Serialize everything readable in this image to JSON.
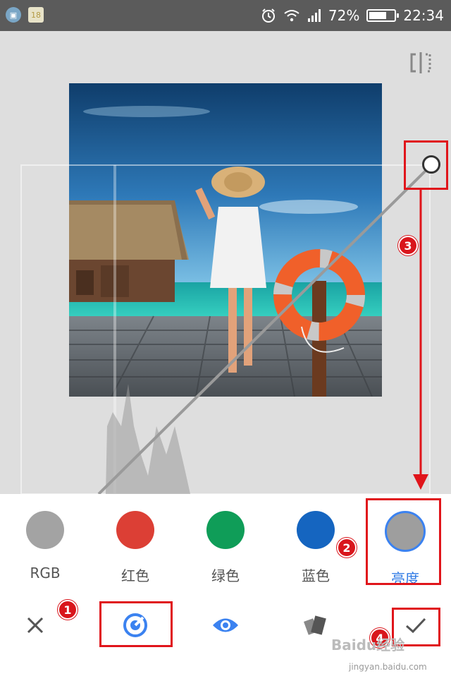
{
  "status_bar": {
    "notification_icons": [
      "image-icon",
      "calendar-icon"
    ],
    "calendar_day": "18",
    "battery_percent": "72%",
    "battery_level": 0.72,
    "time": "22:34"
  },
  "channels": [
    {
      "label": "RGB",
      "color": "#a3a3a3",
      "active": false
    },
    {
      "label": "红色",
      "color": "#dc3f35",
      "active": false
    },
    {
      "label": "绿色",
      "color": "#0f9d58",
      "active": false
    },
    {
      "label": "蓝色",
      "color": "#1565c0",
      "active": false
    },
    {
      "label": "亮度",
      "color": "#9e9e9e",
      "active": true
    }
  ],
  "toolbar": {
    "tools": [
      "close-icon",
      "curves-icon",
      "eye-icon",
      "styles-icon",
      "checkmark-icon"
    ]
  },
  "annotations": {
    "badges": [
      "1",
      "2",
      "3",
      "4"
    ]
  },
  "colors": {
    "accent_blue": "#2f7ae5",
    "annotation_red": "#e0151b",
    "canvas_bg": "#dedede"
  },
  "watermark": {
    "text": "Baidu经验",
    "url": "jingyan.baidu.com"
  }
}
